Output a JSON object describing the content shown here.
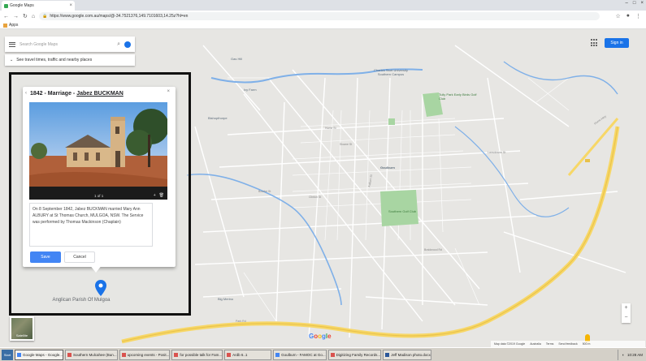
{
  "browser": {
    "tab_title": "Google Maps",
    "tab_close": "×",
    "window_controls": [
      "–",
      "□",
      "×"
    ],
    "url": "https://www.google.com.au/maps/@-34.7521376,149.7101603,14.25z?hl=en",
    "nav_icons": [
      "back-icon",
      "forward-icon",
      "reload-icon",
      "home-icon"
    ],
    "bookmarks_label": "Apps"
  },
  "maps": {
    "search_placeholder": "Search Google Maps",
    "travel_chip": "See travel times, traffic and nearby places",
    "signin_label": "Sign in",
    "satellite_label": "Satellite",
    "zoom_in": "+",
    "zoom_out": "−",
    "footer_items": [
      "Map data ©2019 Google",
      "Australia",
      "Terms",
      "Send feedback",
      "500 m"
    ],
    "pois": [
      {
        "label": "Gas Hill",
        "kind": "gray"
      },
      {
        "label": "Charles Sturt University Southern Campus",
        "kind": "gray"
      },
      {
        "label": "Tully Park Early Birds Golf Club",
        "kind": "green"
      },
      {
        "label": "Ivy Farm",
        "kind": "gray"
      },
      {
        "label": "Bishopthorpe",
        "kind": "gray"
      },
      {
        "label": "Southern Golf Club",
        "kind": "green"
      },
      {
        "label": "Goulburn",
        "kind": "gray"
      },
      {
        "label": "Big Merino",
        "kind": "gray"
      }
    ],
    "streets": [
      "Hume Hwy",
      "Sloane St",
      "Auburn St",
      "Clinton St",
      "Braidwood Rd",
      "Hume St",
      "Bourke St",
      "Park Rd",
      "Lansdowne St"
    ]
  },
  "popup": {
    "back_icon": "‹",
    "title_prefix": "1842 - Marriage - ",
    "title_name": "Jabez BUCKMAN",
    "close_icon": "×",
    "photo_count": "1 of 1",
    "photo_add": "+",
    "photo_delete": "🗑",
    "description": "On 8 September 1842, Jabez BUCKMAN married Mary Ann ALBURY at St Thomas Church, MULGOA, NSW. The Service was performed by Thomas Mackinson (Chaplain)",
    "save_label": "Save",
    "cancel_label": "Cancel",
    "pin_label": "Anglican Parish Of Mulgoa"
  },
  "taskbar": {
    "start": "Start",
    "items": [
      {
        "label": "Google Maps - Google...",
        "icon": "chrome",
        "active": true
      },
      {
        "label": "Southern Mulcahee (Bun...",
        "icon": "pdf",
        "active": false
      },
      {
        "label": "upcoming events - Posit...",
        "icon": "pdf",
        "active": false
      },
      {
        "label": "for possible talk for Fam...",
        "icon": "pdf",
        "active": false
      },
      {
        "label": "Ardb 6..1",
        "icon": "pdf",
        "active": false
      },
      {
        "label": "Goulburn - FAMOC at Go...",
        "icon": "chrome",
        "active": false
      },
      {
        "label": "Digitizing Family Records...",
        "icon": "pdf",
        "active": false
      },
      {
        "label": "Jeff Madison photo.docx",
        "icon": "word",
        "active": false
      }
    ],
    "clock": "10:28 AM"
  }
}
